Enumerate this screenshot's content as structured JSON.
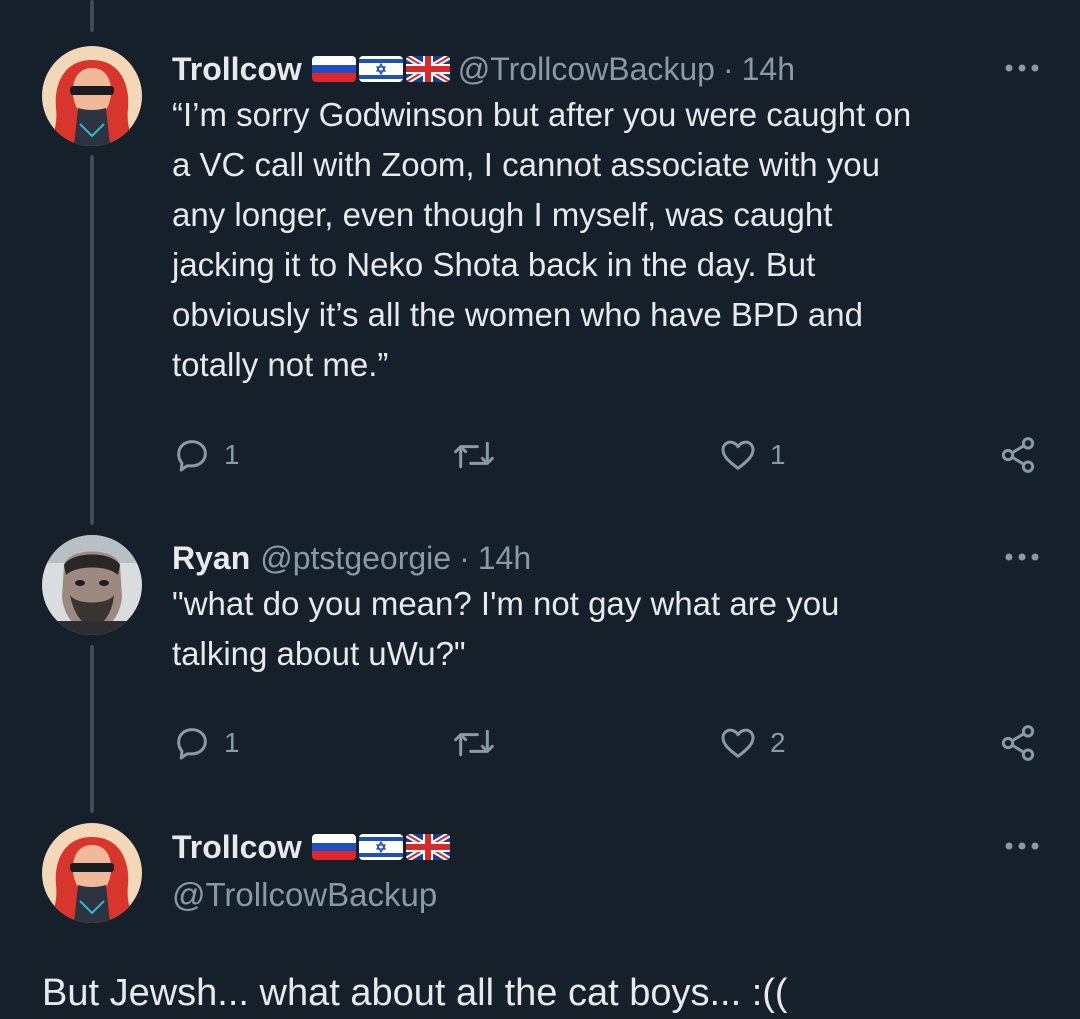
{
  "colors": {
    "background": "#15202b",
    "text_primary": "#e7e9ea",
    "text_secondary": "#8b98a5",
    "thread_line": "#3e4c5a"
  },
  "tweets": [
    {
      "display_name": "Trollcow",
      "flags": [
        "russia-flag-icon",
        "israel-flag-icon",
        "uk-flag-icon"
      ],
      "handle": "@TrollcowBackup",
      "separator": "·",
      "time": "14h",
      "body_lines": [
        "“I’m sorry Godwinson but after you were caught on",
        "a VC call with Zoom, I cannot associate with you",
        "any longer, even though I myself, was caught",
        "jacking it to Neko Shota back in the day. But",
        "obviously it’s all the women who have BPD and",
        "totally not me.”"
      ],
      "replies": "1",
      "retweets": "",
      "likes": "1"
    },
    {
      "display_name": "Ryan",
      "handle": "@ptstgeorgie",
      "separator": "·",
      "time": "14h",
      "body_lines": [
        "\"what do you mean? I'm not gay what are you",
        "talking about uWu?\""
      ],
      "replies": "1",
      "retweets": "",
      "likes": "2"
    },
    {
      "display_name": "Trollcow",
      "flags": [
        "russia-flag-icon",
        "israel-flag-icon",
        "uk-flag-icon"
      ],
      "handle": "@TrollcowBackup",
      "body": "But Jewsh... what about all the cat boys... :(("
    }
  ]
}
